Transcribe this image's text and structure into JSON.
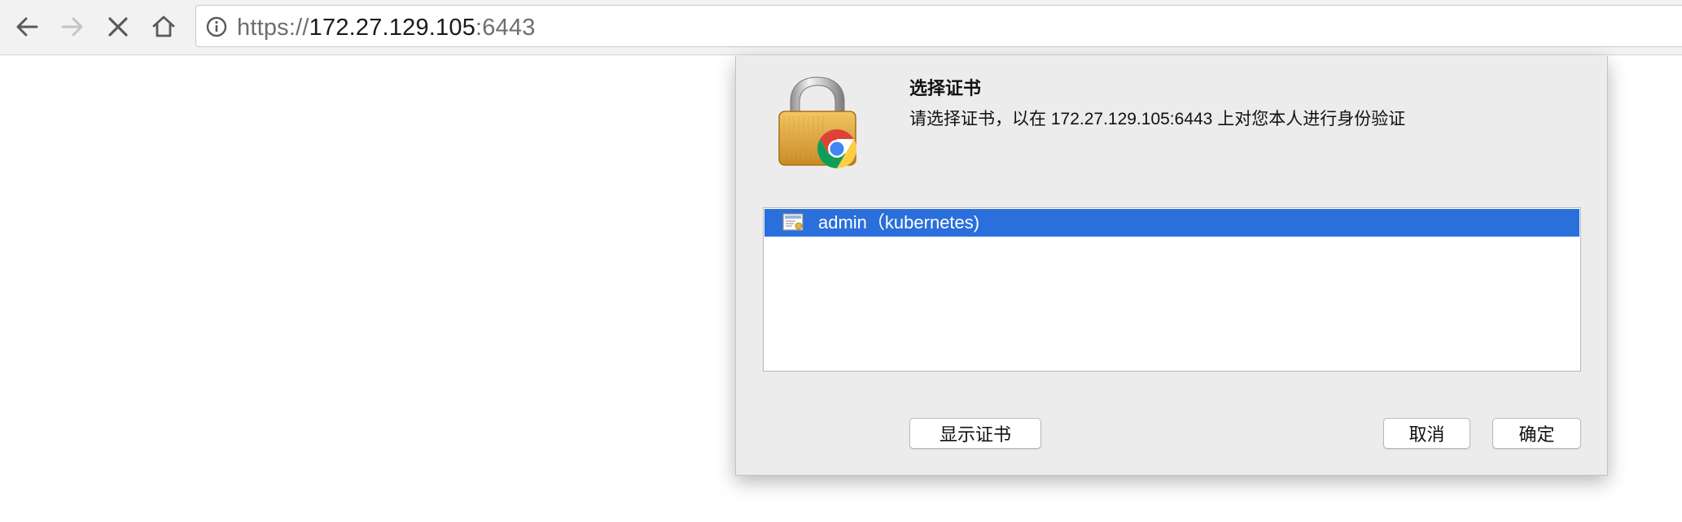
{
  "browser": {
    "back_icon": "arrow-left-icon",
    "forward_icon": "arrow-right-icon",
    "stop_icon": "close-icon",
    "home_icon": "home-icon",
    "site_info_icon": "info-icon",
    "url_scheme": "https://",
    "url_host": "172.27.129.105",
    "url_port": ":6443"
  },
  "dialog": {
    "icon": "chrome-lock-icon",
    "title": "选择证书",
    "message": "请选择证书，以在 172.27.129.105:6443 上对您本人进行身份验证",
    "certificates": [
      {
        "label": "admin（kubernetes)",
        "icon": "certificate-icon",
        "selected": true
      }
    ],
    "show_certificate_button": "显示证书",
    "cancel_button": "取消",
    "ok_button": "确定",
    "selection_color": "#2a6fdb"
  }
}
